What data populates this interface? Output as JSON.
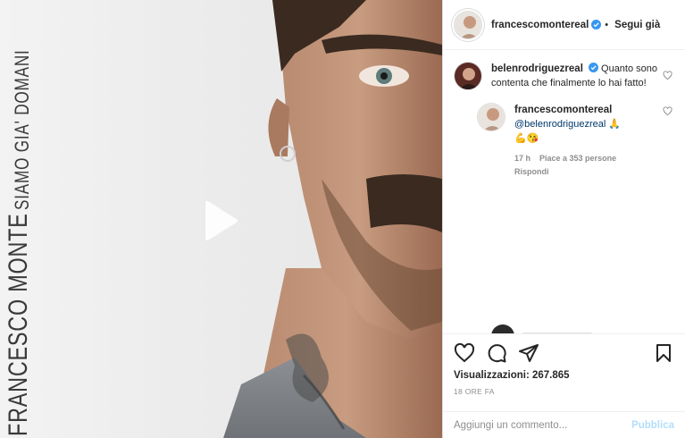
{
  "media": {
    "vertical_title": "FRANCESCO MONTE",
    "vertical_subtitle": "SIAMO GIA' DOMANI",
    "play_icon": "play-icon"
  },
  "post": {
    "author": "francescomontereal",
    "verified": true,
    "follow_separator": "•",
    "follow_label": "Segui già"
  },
  "comments": [
    {
      "username": "belenrodriguezreal",
      "verified": true,
      "text": "Quanto sono contenta che finalmente lo hai fatto!"
    },
    {
      "username": "francescomontereal",
      "mention": "@belenrodriguezreal",
      "emoji_line_1": "🙏",
      "emoji_line_2": "💪😘",
      "time": "17 h",
      "likes": "Piace a 353 persone",
      "reply": "Rispondi"
    }
  ],
  "actions": {
    "like_icon": "heart-icon",
    "comment_icon": "comment-icon",
    "share_icon": "share-icon",
    "save_icon": "bookmark-icon"
  },
  "views": "Visualizzazioni: 267.865",
  "posted_time": "18 ORE FA",
  "composer": {
    "placeholder": "Aggiungi un commento...",
    "publish_label": "Pubblica"
  },
  "colors": {
    "verified_blue": "#3897f0",
    "publish_disabled": "#b2dffc",
    "mention_blue": "#00376b",
    "muted_text": "#8e8e8e"
  }
}
